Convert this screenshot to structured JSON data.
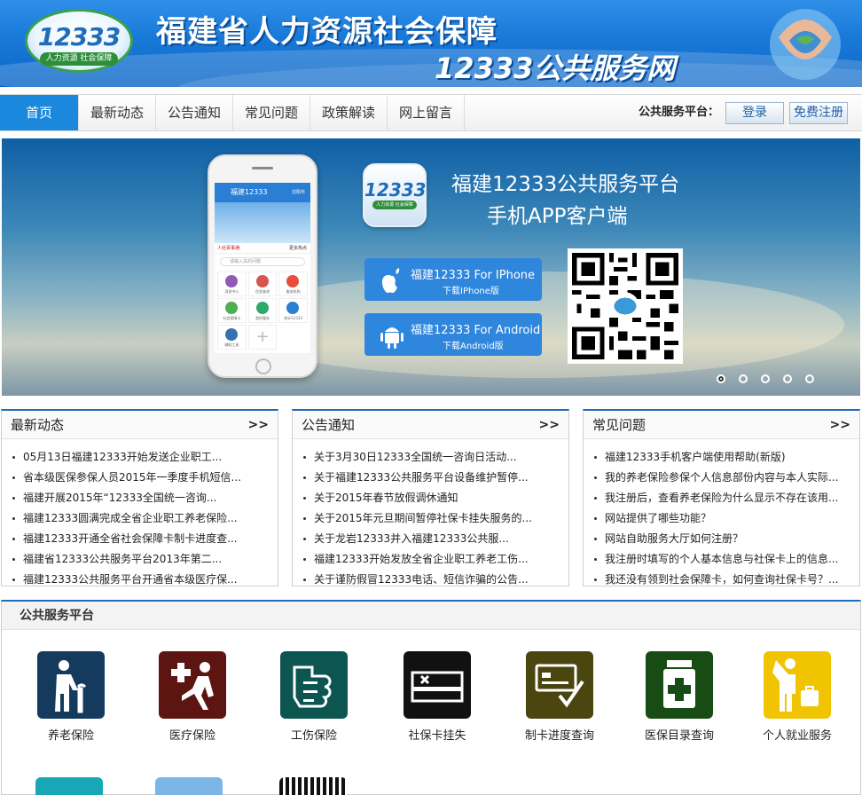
{
  "header": {
    "logo_number": "12333",
    "logo_tagline": "人力资源 社会保障",
    "title_line1": "福建省人力资源社会保障",
    "title_line2": "12333公共服务网"
  },
  "nav": {
    "items": [
      "首页",
      "最新动态",
      "公告通知",
      "常见问题",
      "政策解读",
      "网上留言"
    ],
    "platform_label": "公共服务平台：",
    "login": "登录",
    "register": "免费注册"
  },
  "banner": {
    "phone_title": "福建12333",
    "phone_corner": "沈阳市",
    "phone_notice": "人社百事通:",
    "phone_more": "更多热点",
    "phone_search": "请输入关的问题",
    "phone_cells": [
      "消息中心",
      "信息查询",
      "服务机构",
      "社会保障卡",
      "我的服务",
      "统计12333",
      "辅助工具",
      ""
    ],
    "app_logo_number": "12333",
    "app_logo_tag": "人力资源 社会保障",
    "title": "福建12333公共服务平台",
    "subtitle": "手机APP客户端",
    "iphone_line1": "福建12333 For IPhone",
    "iphone_line2": "下载IPhone版",
    "android_line1": "福建12333 For Android",
    "android_line2": "下载Android版",
    "slide_count": 5,
    "active_slide": 1
  },
  "panels": [
    {
      "title": "最新动态",
      "more": ">>",
      "items": [
        "05月13日福建12333开始发送企业职工...",
        "省本级医保参保人员2015年一季度手机短信...",
        "福建开展2015年“12333全国统一咨询...",
        "福建12333圆满完成全省企业职工养老保险...",
        "福建12333开通全省社会保障卡制卡进度查...",
        "福建省12333公共服务平台2013年第二...",
        "福建12333公共服务平台开通省本级医疗保..."
      ]
    },
    {
      "title": "公告通知",
      "more": ">>",
      "items": [
        "关于3月30日12333全国统一咨询日活动...",
        "关于福建12333公共服务平台设备维护暂停...",
        "关于2015年春节放假调休通知",
        "关于2015年元旦期间暂停社保卡挂失服务的...",
        "关于龙岩12333并入福建12333公共服...",
        "福建12333开始发放全省企业职工养老工伤...",
        "关于谨防假冒12333电话、短信诈骗的公告..."
      ]
    },
    {
      "title": "常见问题",
      "more": ">>",
      "items": [
        "福建12333手机客户端使用帮助(新版)",
        "我的养老保险参保个人信息部份内容与本人实际...",
        "我注册后，查看养老保险为什么显示不存在该用...",
        "网站提供了哪些功能？",
        "网站自助服务大厅如何注册？",
        "我注册时填写的个人基本信息与社保卡上的信息...",
        "我还没有领到社会保障卡，如何查询社保卡号？..."
      ]
    }
  ],
  "services": {
    "title": "公共服务平台",
    "tiles": [
      {
        "label": "养老保险",
        "icon": "elderly-icon",
        "color": "#143a5e"
      },
      {
        "label": "医疗保险",
        "icon": "medical-icon",
        "color": "#5c1510"
      },
      {
        "label": "工伤保险",
        "icon": "injury-icon",
        "color": "#0d5550"
      },
      {
        "label": "社保卡挂失",
        "icon": "card-loss-icon",
        "color": "#111111"
      },
      {
        "label": "制卡进度查询",
        "icon": "card-progress-icon",
        "color": "#4b4610"
      },
      {
        "label": "医保目录查询",
        "icon": "medicine-catalog-icon",
        "color": "#174d14"
      },
      {
        "label": "个人就业服务",
        "icon": "employment-icon",
        "color": "#f0c400"
      }
    ]
  }
}
